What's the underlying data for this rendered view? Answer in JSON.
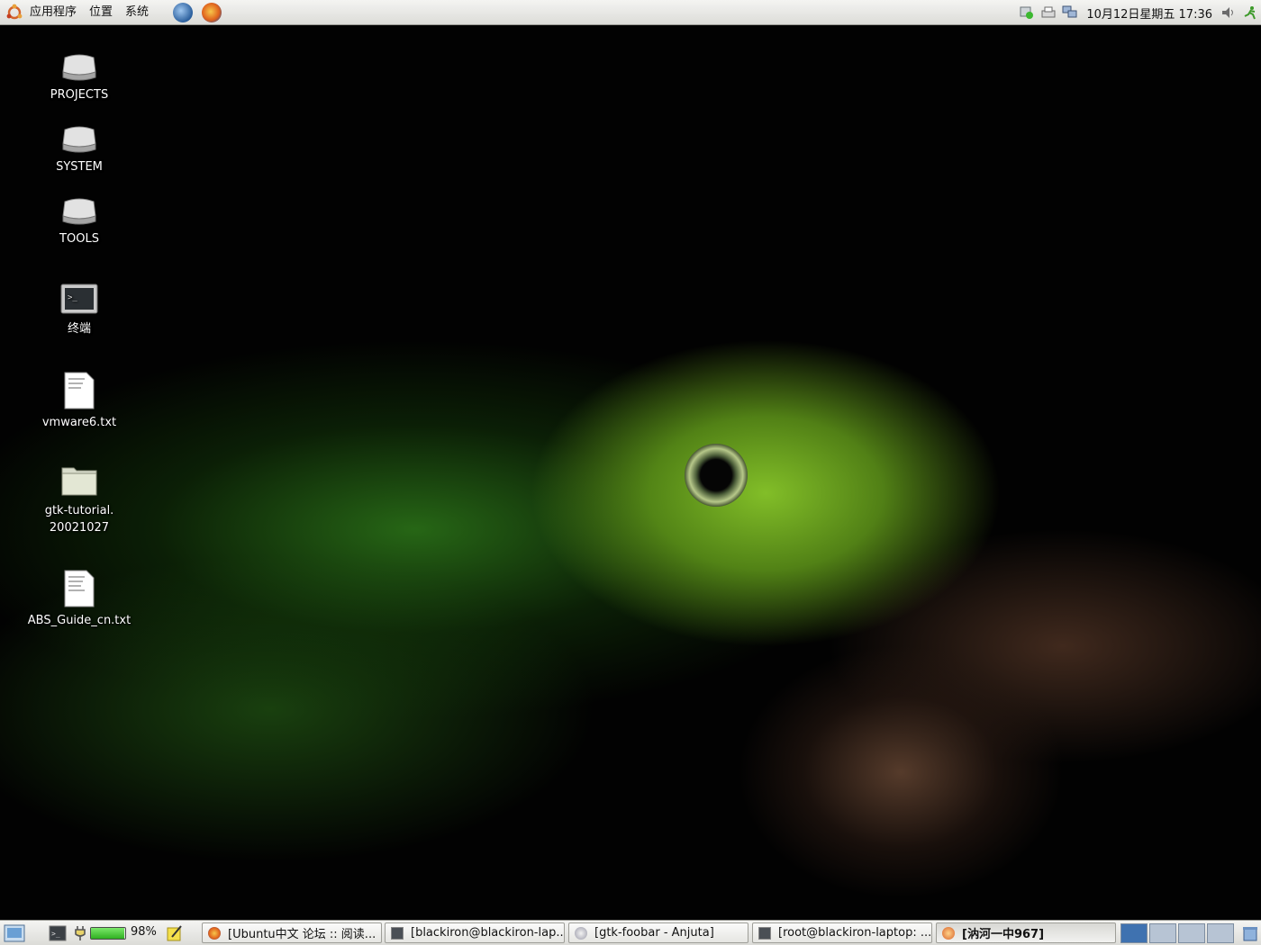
{
  "top_panel": {
    "menus": [
      "应用程序",
      "位置",
      "系统"
    ],
    "clock": "10月12日星期五 17:36"
  },
  "desktop": {
    "icons": [
      {
        "label": "PROJECTS",
        "icon": "drive-icon"
      },
      {
        "label": "SYSTEM",
        "icon": "drive-icon"
      },
      {
        "label": "TOOLS",
        "icon": "drive-icon"
      },
      {
        "label": "终端",
        "icon": "terminal-icon"
      },
      {
        "label": "vmware6.txt",
        "icon": "text-file-icon"
      },
      {
        "label": "gtk-tutorial.\n20021027",
        "icon": "folder-icon"
      },
      {
        "label": "ABS_Guide_cn.txt",
        "icon": "text-file-icon"
      }
    ]
  },
  "bottom_panel": {
    "battery_percent": "98%",
    "battery_level": 0.98,
    "tasks": [
      {
        "label": "[Ubuntu中文 论坛 :: 阅读...",
        "icon": "firefox-icon"
      },
      {
        "label": "[blackiron@blackiron-lap...",
        "icon": "terminal-icon"
      },
      {
        "label": "[gtk-foobar - Anjuta]",
        "icon": "anjuta-icon"
      },
      {
        "label": "[root@blackiron-laptop: ...",
        "icon": "terminal-icon"
      },
      {
        "label": "[汭河一中967]",
        "icon": "chat-icon",
        "active": true
      }
    ],
    "workspace_count": 4,
    "active_workspace": 1
  },
  "colors": {
    "panel_bg": "#e8e8e4",
    "workspace_active": "#3f72b0",
    "workspace_inactive": "#b7c4d4",
    "battery_green": "#3ecb2a"
  }
}
